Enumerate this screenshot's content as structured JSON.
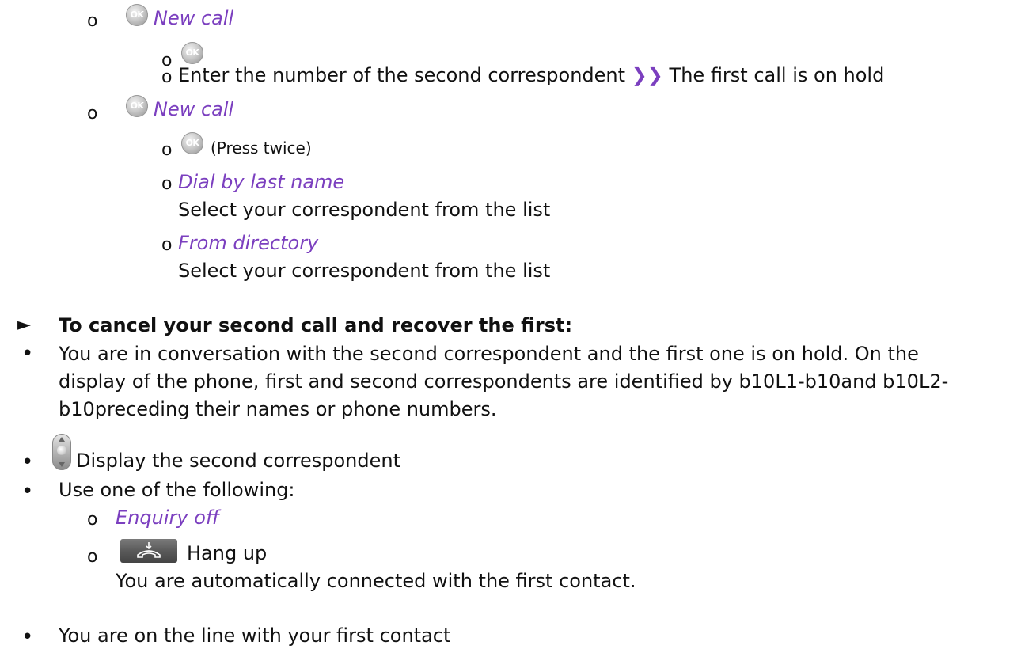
{
  "items": {
    "new_call_1": "New call",
    "enter_number": "Enter the number of the second correspondent",
    "arrows": "❯❯",
    "first_on_hold": "The first call is on hold",
    "new_call_2": "New call",
    "press_twice": "(Press twice)",
    "dial_by_last_name": "Dial by last name",
    "select_1": "Select your correspondent from the list",
    "from_directory": "From directory",
    "select_2": "Select your correspondent from the list"
  },
  "section": {
    "marker": "►",
    "heading": "To cancel your second call and recover the first:",
    "para_line1": "You are in conversation with the second correspondent and the first one is on hold. On the",
    "para_line2": "display of the phone, first and second correspondents are identified by b10L1-b10and b10L2-",
    "para_line3": "b10preceding their names or phone numbers.",
    "display_second": "Display the second correspondent",
    "use_one": "Use one of the following:",
    "enquiry_off": "Enquiry off",
    "hang_up": "Hang up",
    "auto_connected": "You are automatically connected with the first contact.",
    "on_line": "You are on the line with your first contact"
  },
  "icons": {
    "ok_label": "OK",
    "ok": "ok-key-icon",
    "navigator": "navigator-icon",
    "hangup": "hangup-key-icon"
  },
  "colors": {
    "accent": "#7b3fbf"
  },
  "bullets": {
    "circle": "o",
    "dot": "•"
  }
}
